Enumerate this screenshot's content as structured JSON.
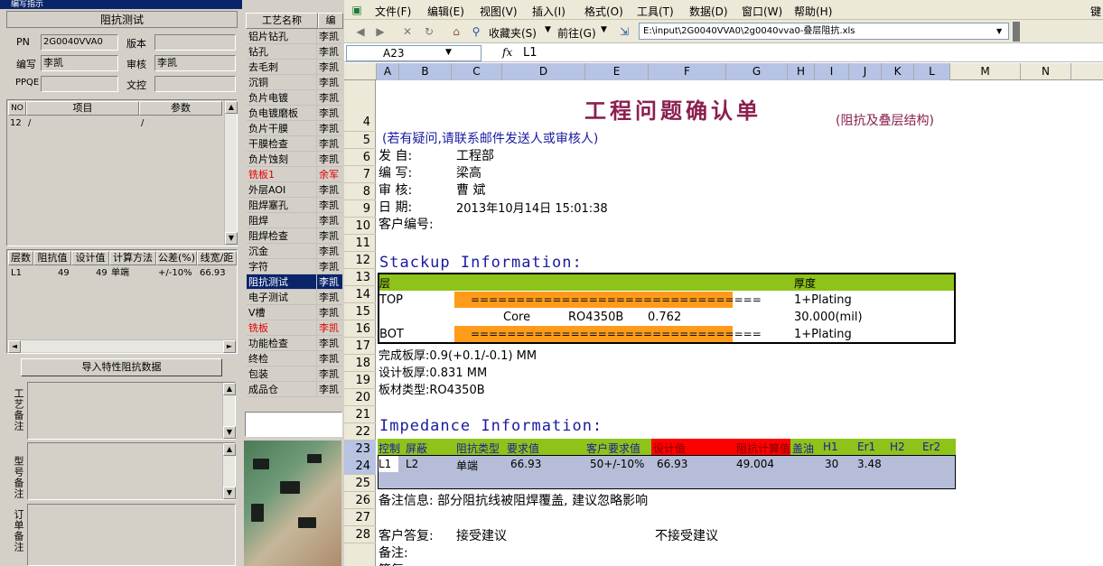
{
  "left_panel": {
    "title": "编写指示",
    "section_title": "阻抗测试",
    "pn_label": "PN",
    "pn_value": "2G0040VVA0",
    "version_label": "版本",
    "version_value": "",
    "author_label": "编写",
    "author_value": "李凯",
    "reviewer_label": "审核",
    "reviewer_value": "李凯",
    "ppqe_label": "PPQE",
    "ppqe_value": "",
    "doc_label": "文控",
    "doc_value": "",
    "item_grid": {
      "headers": [
        "NO",
        "项目",
        "参数"
      ],
      "rows": [
        [
          "12",
          "/",
          "/"
        ]
      ]
    },
    "imp_grid": {
      "headers": [
        "层数",
        "阻抗值",
        "设计值",
        "计算方法",
        "公差(%)",
        "线宽/距"
      ],
      "rows": [
        [
          "L1",
          "49",
          "49",
          "单端",
          "+/-10%",
          "66.93"
        ]
      ]
    },
    "import_button": "导入特性阻抗数据",
    "remark_process": "工艺备注",
    "remark_model": "型号备注",
    "remark_order": "订单备注"
  },
  "process_list": {
    "header_name": "工艺名称",
    "header_writer": "编",
    "rows": [
      {
        "name": "铝片钻孔",
        "writer": "李凯",
        "state": "normal"
      },
      {
        "name": "钻孔",
        "writer": "李凯",
        "state": "normal"
      },
      {
        "name": "去毛刺",
        "writer": "李凯",
        "state": "normal"
      },
      {
        "name": "沉铜",
        "writer": "李凯",
        "state": "normal"
      },
      {
        "name": "负片电镀",
        "writer": "李凯",
        "state": "normal"
      },
      {
        "name": "负电镀磨板",
        "writer": "李凯",
        "state": "normal"
      },
      {
        "name": "负片干膜",
        "writer": "李凯",
        "state": "normal"
      },
      {
        "name": "干膜检查",
        "writer": "李凯",
        "state": "normal"
      },
      {
        "name": "负片蚀刻",
        "writer": "李凯",
        "state": "normal"
      },
      {
        "name": "铣板1",
        "writer": "余军",
        "state": "red"
      },
      {
        "name": "外层AOI",
        "writer": "李凯",
        "state": "normal"
      },
      {
        "name": "阻焊塞孔",
        "writer": "李凯",
        "state": "normal"
      },
      {
        "name": "阻焊",
        "writer": "李凯",
        "state": "normal"
      },
      {
        "name": "阻焊检查",
        "writer": "李凯",
        "state": "normal"
      },
      {
        "name": "沉金",
        "writer": "李凯",
        "state": "normal"
      },
      {
        "name": "字符",
        "writer": "李凯",
        "state": "normal"
      },
      {
        "name": "阻抗测试",
        "writer": "李凯",
        "state": "selected"
      },
      {
        "name": "电子测试",
        "writer": "李凯",
        "state": "normal"
      },
      {
        "name": "V槽",
        "writer": "李凯",
        "state": "normal"
      },
      {
        "name": "铣板",
        "writer": "李凯",
        "state": "red"
      },
      {
        "name": "功能检查",
        "writer": "李凯",
        "state": "normal"
      },
      {
        "name": "终检",
        "writer": "李凯",
        "state": "normal"
      },
      {
        "name": "包装",
        "writer": "李凯",
        "state": "normal"
      },
      {
        "name": "成品仓",
        "writer": "李凯",
        "state": "normal"
      }
    ]
  },
  "excel": {
    "menu": [
      "文件(F)",
      "编辑(E)",
      "视图(V)",
      "插入(I)",
      "格式(O)",
      "工具(T)",
      "数据(D)",
      "窗口(W)",
      "帮助(H)"
    ],
    "overflow_char": "键",
    "toolbar": {
      "favorites": "收藏夹(S)",
      "goto": "前往(G)",
      "address": "E:\\input\\2G0040VVA0\\2g0040vva0-叠层阻抗.xls"
    },
    "name_box": "A23",
    "fx": "fx",
    "formula": "L1",
    "columns": [
      "A",
      "B",
      "C",
      "D",
      "E",
      "F",
      "G",
      "H",
      "I",
      "J",
      "K",
      "L",
      "M",
      "N"
    ],
    "rows": [
      "4",
      "5",
      "6",
      "7",
      "8",
      "9",
      "10",
      "11",
      "12",
      "13",
      "14",
      "15",
      "16",
      "17",
      "18",
      "19",
      "20",
      "21",
      "22",
      "23",
      "24",
      "25",
      "26",
      "27",
      "28"
    ],
    "title": "工程问题确认单",
    "subtitle": "(阻抗及叠层结构)",
    "note": "(若有疑问,请联系邮件发送人或审核人)",
    "from_label": "发    自:",
    "from_value": "工程部",
    "writer_label": "编    写:",
    "writer_value": "梁高",
    "review_label": "审    核:",
    "review_value": "曹  斌",
    "date_label": "日    期:",
    "date_value": "2013年10月14日 15:01:38",
    "customer_label": "客户编号:",
    "stackup_title": "Stackup Information:",
    "stackup": {
      "h_layer": "层",
      "h_thickness": "厚度",
      "top": "TOP",
      "bar1": "================================",
      "top_thick": "1+Plating",
      "core": "Core",
      "core_mat": "RO4350B",
      "core_val": "0.762",
      "core_thick": "30.000(mil)",
      "bot": "BOT",
      "bar2": "================================",
      "bot_thick": "1+Plating"
    },
    "finish_thickness": "完成板厚:0.9(+0.1/-0.1) MM",
    "design_thickness": "设计板厚:0.831 MM",
    "material": "板材类型:RO4350B",
    "impedance_title": "Impedance Information:",
    "imp_headers": [
      "控制",
      "屏蔽",
      "阻抗类型",
      "要求值",
      "客户要求值",
      "设计值",
      "阻抗计算值",
      "盖油",
      "H1",
      "Er1",
      "H2",
      "Er2"
    ],
    "imp_row": [
      "L1",
      "L2",
      "单端",
      "66.93",
      "50+/-10%",
      "66.93",
      "49.004",
      "",
      "30",
      "3.48",
      "",
      ""
    ],
    "remark": "备注信息:  部分阻抗线被阻焊覆盖, 建议忽略影响",
    "reply_label": "客户答复:",
    "accept": "接受建议",
    "reject": "不接受建议",
    "remark2": "备注:",
    "sign": "签复"
  }
}
